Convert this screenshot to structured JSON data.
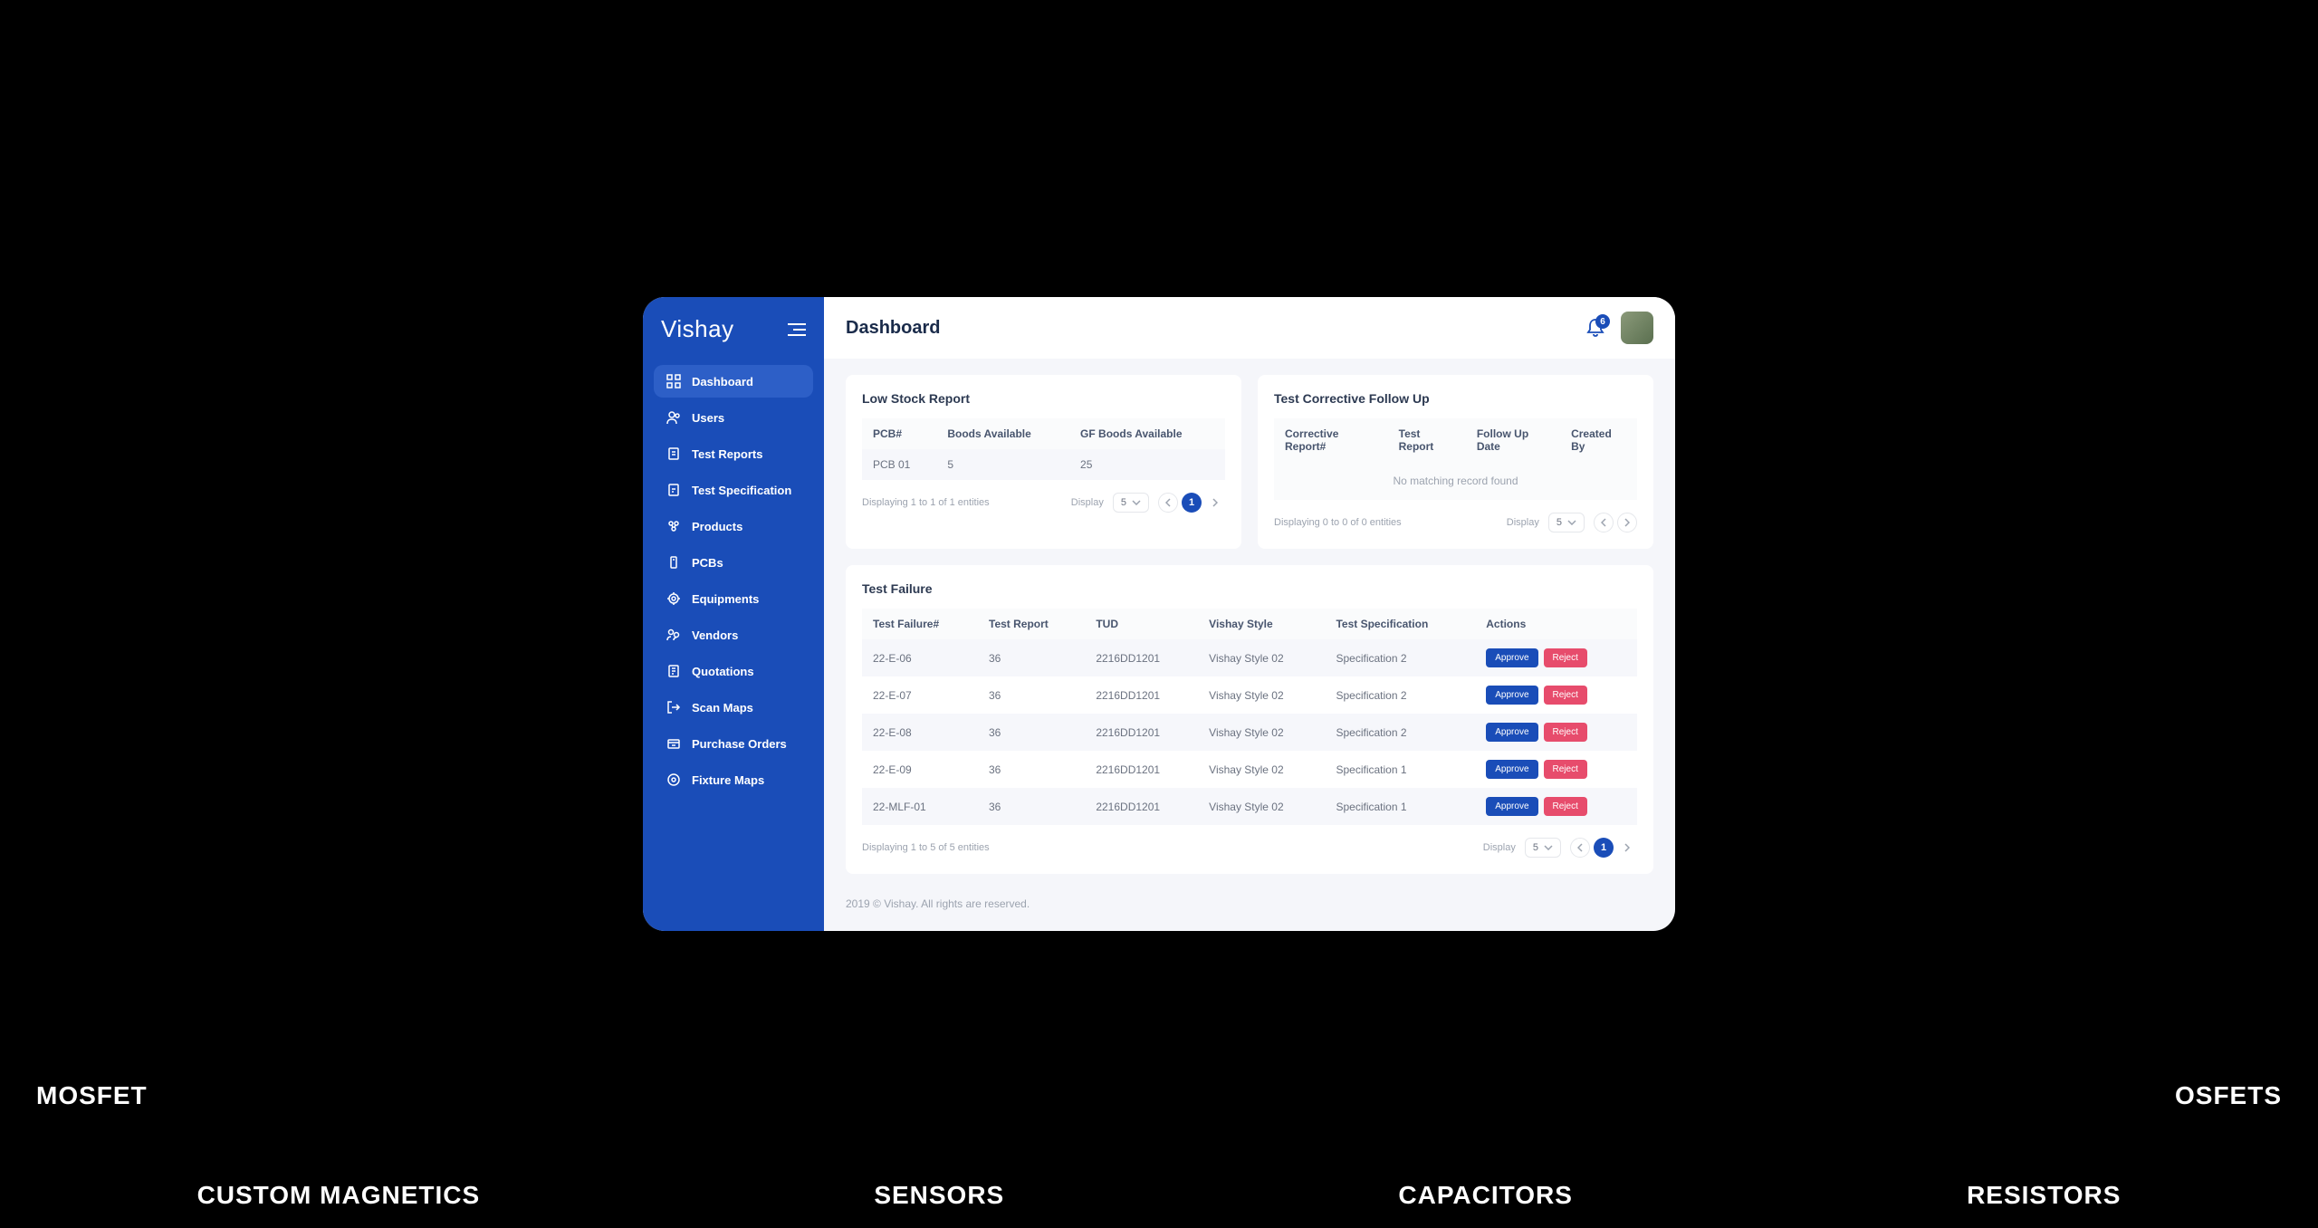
{
  "brand": "Vishay",
  "page_title": "Dashboard",
  "notification_count": "6",
  "sidebar": {
    "items": [
      {
        "label": "Dashboard",
        "active": true
      },
      {
        "label": "Users"
      },
      {
        "label": "Test Reports"
      },
      {
        "label": "Test Specification"
      },
      {
        "label": "Products"
      },
      {
        "label": "PCBs"
      },
      {
        "label": "Equipments"
      },
      {
        "label": "Vendors"
      },
      {
        "label": "Quotations"
      },
      {
        "label": "Scan Maps"
      },
      {
        "label": "Purchase Orders"
      },
      {
        "label": "Fixture Maps"
      }
    ]
  },
  "low_stock": {
    "title": "Low Stock Report",
    "headers": [
      "PCB#",
      "Boods Available",
      "GF Boods Available"
    ],
    "rows": [
      {
        "pcb": "PCB 01",
        "boods": "5",
        "gf_boods": "25"
      }
    ],
    "footer_text": "Displaying 1 to 1 of 1 entities",
    "display_label": "Display",
    "display_value": "5",
    "current_page": "1"
  },
  "corrective": {
    "title": "Test Corrective Follow Up",
    "headers": [
      "Corrective Report#",
      "Test Report",
      "Follow Up Date",
      "Created By"
    ],
    "no_data": "No matching record found",
    "footer_text": "Displaying 0 to 0 of 0 entities",
    "display_label": "Display",
    "display_value": "5"
  },
  "test_failure": {
    "title": "Test Failure",
    "headers": [
      "Test Failure#",
      "Test Report",
      "TUD",
      "Vishay Style",
      "Test Specification",
      "Actions"
    ],
    "rows": [
      {
        "id": "22-E-06",
        "report": "36",
        "tud": "2216DD1201",
        "style": "Vishay Style 02",
        "spec": "Specification 2"
      },
      {
        "id": "22-E-07",
        "report": "36",
        "tud": "2216DD1201",
        "style": "Vishay Style 02",
        "spec": "Specification 2"
      },
      {
        "id": "22-E-08",
        "report": "36",
        "tud": "2216DD1201",
        "style": "Vishay Style 02",
        "spec": "Specification 2"
      },
      {
        "id": "22-E-09",
        "report": "36",
        "tud": "2216DD1201",
        "style": "Vishay Style 02",
        "spec": "Specification 1"
      },
      {
        "id": "22-MLF-01",
        "report": "36",
        "tud": "2216DD1201",
        "style": "Vishay Style 02",
        "spec": "Specification 1"
      }
    ],
    "approve_label": "Approve",
    "reject_label": "Reject",
    "footer_text": "Displaying 1 to 5 of 5 entities",
    "display_label": "Display",
    "display_value": "5",
    "current_page": "1"
  },
  "footer": "2019 © Vishay. All rights are reserved.",
  "bg_words": [
    "CUSTOM MAGNETICS",
    "SENSORS",
    "CAPACITORS",
    "RESISTORS"
  ],
  "bg_top": "MOSFET",
  "bg_top2": "OSFETS"
}
